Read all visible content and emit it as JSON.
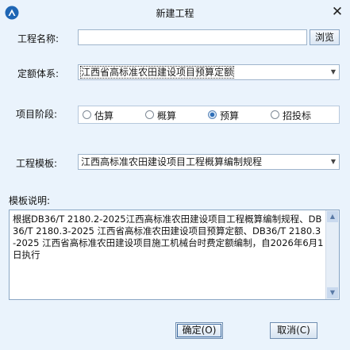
{
  "window": {
    "title": "新建工程",
    "close_glyph": "✕"
  },
  "form": {
    "project_name_label": "工程名称:",
    "project_name_value": "",
    "browse_label": "浏览",
    "quota_system_label": "定额体系:",
    "quota_system_value": "江西省高标准农田建设项目预算定额",
    "stage_label": "项目阶段:",
    "stage_options": [
      {
        "label": "估算",
        "checked": false
      },
      {
        "label": "概算",
        "checked": false
      },
      {
        "label": "预算",
        "checked": true
      },
      {
        "label": "招投标",
        "checked": false
      }
    ],
    "template_label": "工程模板:",
    "template_value": "江西高标准农田建设项目工程概算编制规程",
    "description_label": "模板说明:",
    "description_text": "根据DB36/T 2180.2-2025江西高标准农田建设项目工程概算编制规程、DB36/T 2180.3-2025 江西省高标准农田建设项目预算定额、DB36/T 2180.3-2025 江西省高标准农田建设项目施工机械台时费定额编制，自2026年6月1日执行"
  },
  "buttons": {
    "ok_label": "确定(O)",
    "cancel_label": "取消(C)"
  },
  "icons": {
    "app": "app-logo-icon",
    "dropdown": "chevron-down-icon",
    "scroll_up": "scroll-up-arrow-icon",
    "scroll_down": "scroll-down-arrow-icon",
    "close": "close-icon"
  }
}
